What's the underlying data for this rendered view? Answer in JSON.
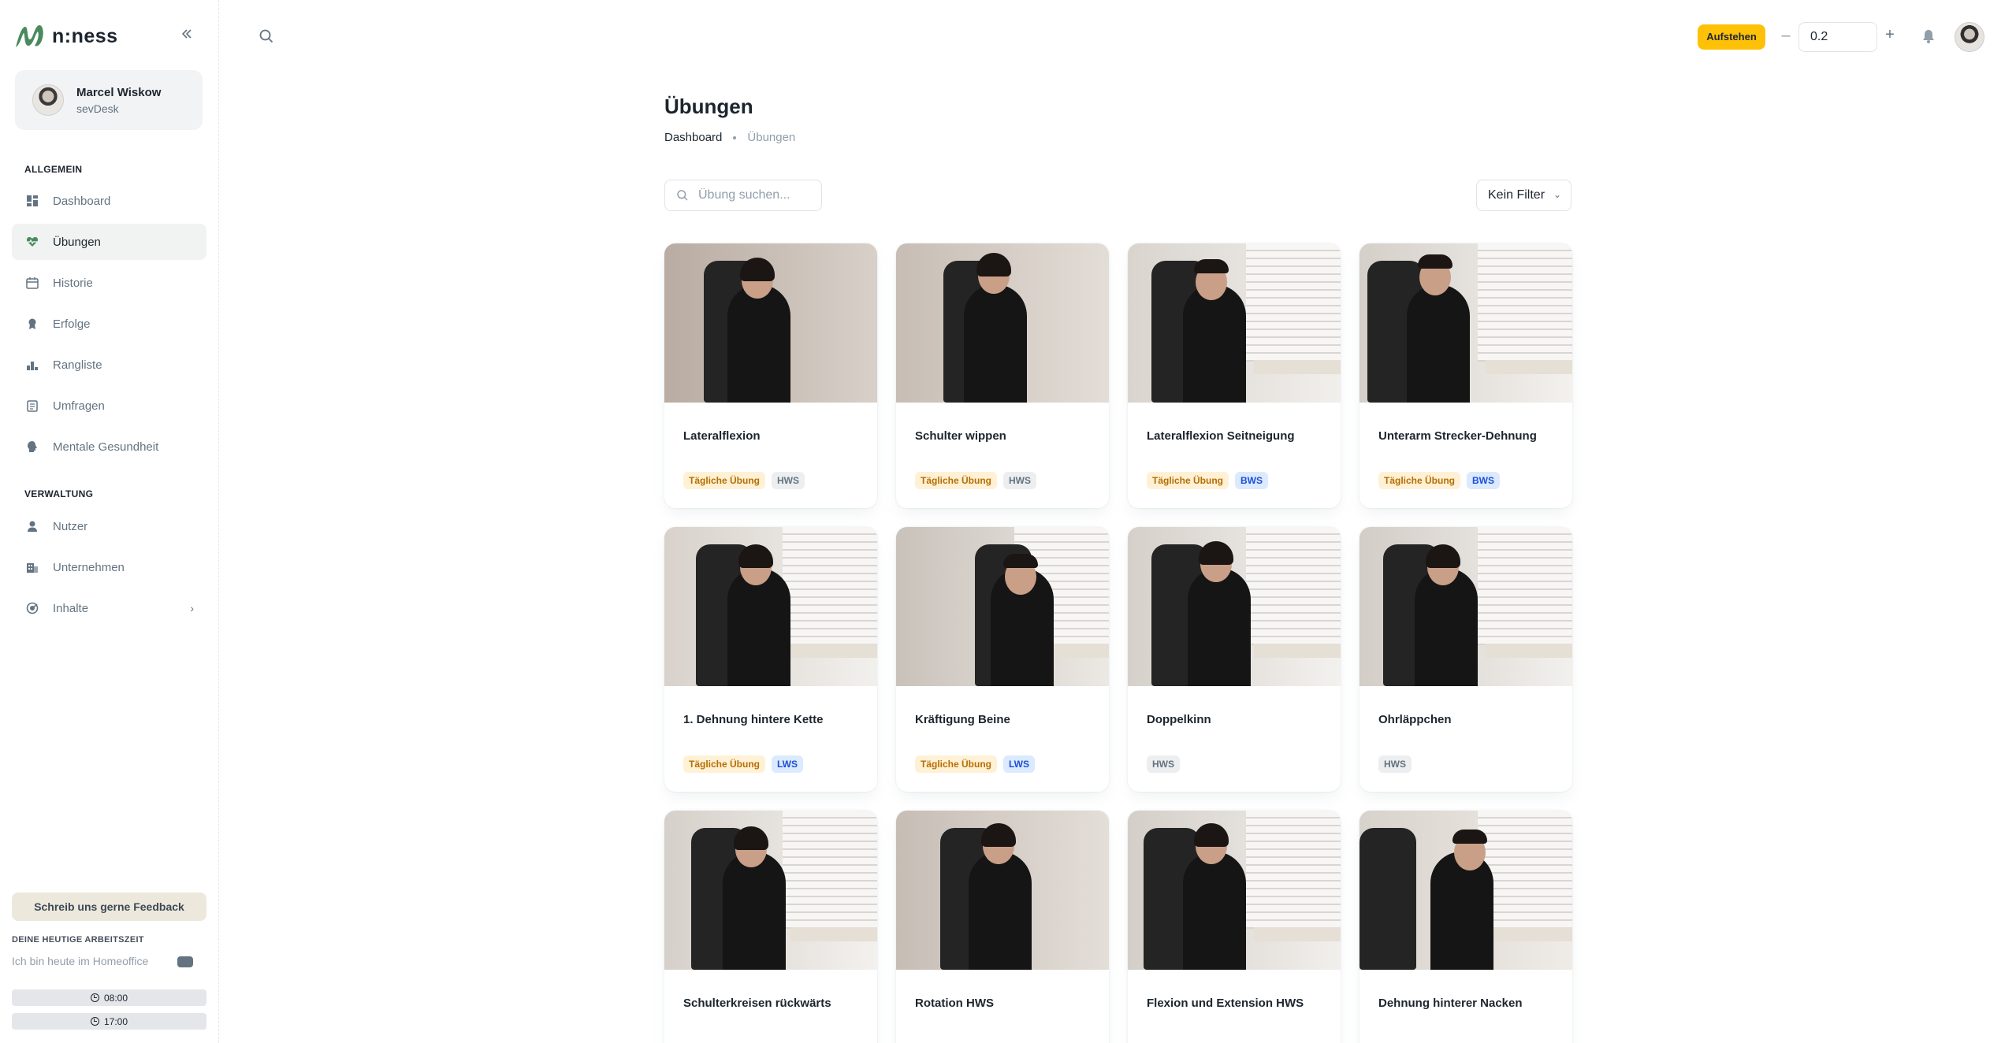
{
  "brand": {
    "name": "n:ness",
    "accent": "#4a8a5c"
  },
  "account": {
    "name": "Marcel Wiskow",
    "company": "sevDesk"
  },
  "nav": {
    "section_general": "ALLGEMEIN",
    "section_admin": "VERWALTUNG",
    "items": [
      {
        "label": "Dashboard",
        "icon": "dashboard-icon"
      },
      {
        "label": "Übungen",
        "icon": "heart-pulse-icon",
        "active": true
      },
      {
        "label": "Historie",
        "icon": "calendar-icon"
      },
      {
        "label": "Erfolge",
        "icon": "medal-icon"
      },
      {
        "label": "Rangliste",
        "icon": "leaderboard-icon"
      },
      {
        "label": "Umfragen",
        "icon": "clipboard-icon"
      },
      {
        "label": "Mentale Gesundheit",
        "icon": "head-icon"
      },
      {
        "label": "Nutzer",
        "icon": "user-icon"
      },
      {
        "label": "Unternehmen",
        "icon": "building-icon"
      },
      {
        "label": "Inhalte",
        "icon": "content-icon"
      }
    ]
  },
  "feedback": {
    "label": "Schreib uns gerne Feedback"
  },
  "worktime": {
    "title": "DEINE HEUTIGE ARBEITSZEIT",
    "homeoffice_label": "Ich bin heute im Homeoffice",
    "start": "08:00",
    "end": "17:00"
  },
  "header": {
    "standup_label": "Aufstehen",
    "standup_color": "#ffc107",
    "stepper_value": "0.2",
    "stepper_minus": "–",
    "stepper_plus": "+"
  },
  "page": {
    "title": "Übungen",
    "breadcrumb": [
      "Dashboard",
      "Übungen"
    ],
    "search_placeholder": "Übung suchen...",
    "filter_value": "Kein Filter"
  },
  "exercises": [
    {
      "title": "Lateralflexion",
      "tags": [
        "Tägliche Übung",
        "HWS"
      ]
    },
    {
      "title": "Schulter wippen",
      "tags": [
        "Tägliche Übung",
        "HWS"
      ]
    },
    {
      "title": "Lateralflexion Seitneigung",
      "tags": [
        "Tägliche Übung",
        "BWS"
      ]
    },
    {
      "title": "Unterarm Strecker-Dehnung",
      "tags": [
        "Tägliche Übung",
        "BWS"
      ]
    },
    {
      "title": "1. Dehnung hintere Kette",
      "tags": [
        "Tägliche Übung",
        "LWS"
      ]
    },
    {
      "title": "Kräftigung Beine",
      "tags": [
        "Tägliche Übung",
        "LWS"
      ]
    },
    {
      "title": "Doppelkinn",
      "tags": [
        "HWS"
      ]
    },
    {
      "title": "Ohrläppchen",
      "tags": [
        "HWS"
      ]
    },
    {
      "title": "Schulterkreisen rückwärts",
      "tags": []
    },
    {
      "title": "Rotation HWS",
      "tags": []
    },
    {
      "title": "Flexion und Extension HWS",
      "tags": []
    },
    {
      "title": "Dehnung hinterer Nacken",
      "tags": []
    }
  ]
}
